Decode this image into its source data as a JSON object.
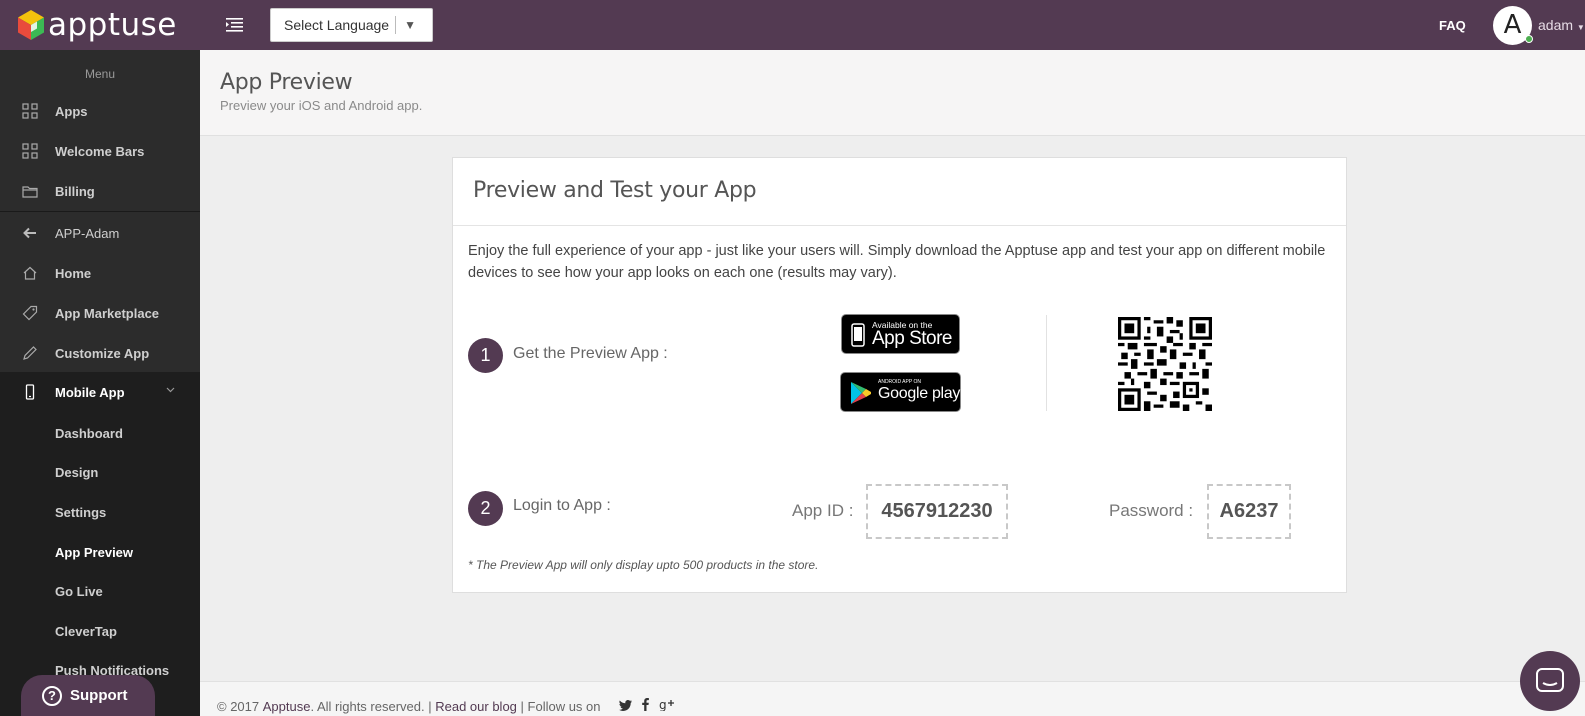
{
  "header": {
    "logo_text": "apptuse",
    "language_select": "Select Language",
    "faq_label": "FAQ",
    "avatar_initial": "A",
    "username": "adam",
    "colors": {
      "topbar": "#533a52",
      "accent": "#533a52",
      "online": "#4caf50"
    }
  },
  "sidebar": {
    "menu_label": "Menu",
    "items": [
      {
        "label": "Apps",
        "icon": "grid-icon"
      },
      {
        "label": "Welcome Bars",
        "icon": "grid-icon"
      },
      {
        "label": "Billing",
        "icon": "folder-icon"
      },
      {
        "label": "APP-Adam",
        "icon": "arrow-left-icon"
      },
      {
        "label": "Home",
        "icon": "home-icon"
      },
      {
        "label": "App Marketplace",
        "icon": "tag-icon"
      },
      {
        "label": "Customize App",
        "icon": "pencil-icon"
      },
      {
        "label": "Mobile App",
        "icon": "phone-icon"
      }
    ],
    "sub_items": [
      "Dashboard",
      "Design",
      "Settings",
      "App Preview",
      "Go Live",
      "CleverTap",
      "Push Notifications"
    ],
    "support_label": "Support"
  },
  "page": {
    "title": "App Preview",
    "subtitle": "Preview your iOS and Android app."
  },
  "card": {
    "title": "Preview and Test your App",
    "intro": "Enjoy the full experience of your app - just like your users will. Simply download the Apptuse app and test your app on different mobile devices to see how your app looks on each one (results may vary).",
    "step1_number": "1",
    "step1_label": "Get the Preview App :",
    "appstore_small": "Available on the",
    "appstore_big": "App Store",
    "gplay_small": "ANDROID APP ON",
    "gplay_big": "Google play",
    "step2_number": "2",
    "step2_label": "Login to App :",
    "app_id_label": "App ID :",
    "app_id_value": "4567912230",
    "password_label": "Password :",
    "password_value": "A6237",
    "note": "* The Preview App will only display upto 500 products in the store."
  },
  "footer": {
    "copyright": "© 2017",
    "brand": "Apptuse",
    "rights": ". All rights reserved. |",
    "blog_link": "Read our blog",
    "follow": "| Follow us on",
    "social": [
      "twitter-icon",
      "facebook-icon",
      "google-plus-icon"
    ]
  }
}
